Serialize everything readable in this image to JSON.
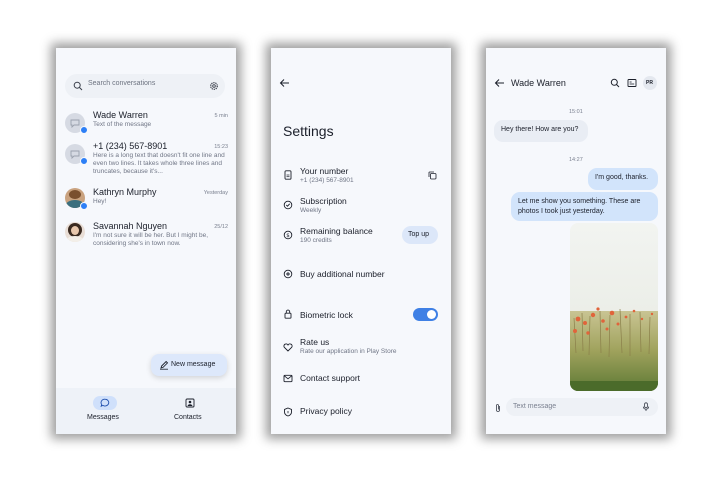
{
  "conversations_screen": {
    "search_placeholder": "Search conversations",
    "conversations": [
      {
        "name": "Wade Warren",
        "time": "5 min",
        "message": "Text of the message",
        "unread": true
      },
      {
        "name": "+1 (234) 567-8901",
        "time": "15:23",
        "message": "Here is a long text that doesn't fit one line and even two lines. It takes whole three lines and truncates, because it's...",
        "unread": true
      },
      {
        "name": "Kathryn Murphy",
        "time": "Yesterday",
        "message": "Hey!",
        "unread": true
      },
      {
        "name": "Savannah Nguyen",
        "time": "25/12",
        "message": "I'm not sure it will be her. But I might be, considering she's in town now.",
        "unread": false
      }
    ],
    "new_message_label": "New message",
    "nav": {
      "messages": "Messages",
      "contacts": "Contacts"
    }
  },
  "settings_screen": {
    "title": "Settings",
    "your_number": {
      "label": "Your number",
      "value": "+1 (234) 567-8901"
    },
    "subscription": {
      "label": "Subscription",
      "value": "Weekly"
    },
    "balance": {
      "label": "Remaining balance",
      "value": "190 credits",
      "button": "Top up"
    },
    "buy_number": "Buy additional number",
    "biometric_lock": {
      "label": "Biometric lock",
      "enabled": true
    },
    "rate_us": {
      "label": "Rate us",
      "sub": "Rate our application in Play Store"
    },
    "contact_support": "Contact support",
    "privacy_policy": "Privacy policy"
  },
  "chat_screen": {
    "contact_name": "Wade Warren",
    "avatar_initials": "PR",
    "time_1": "15:01",
    "msg_1": "Hey there! How are you?",
    "time_2": "14:27",
    "msg_2": "I'm good, thanks.",
    "msg_3": "Let me show you something. These are photos I took just yesterday.",
    "input_placeholder": "Text message"
  },
  "colors": {
    "accent": "#3f80e5",
    "unread_dot": "#2d7ff6",
    "outgoing_bubble": "#d2e4fb",
    "incoming_bubble": "#e9edf4",
    "screen_bg": "#f6f8fc"
  },
  "icons": [
    "search-icon",
    "settings-gear-icon",
    "person-avatar-icon",
    "pencil-icon",
    "chat-icon",
    "contacts-icon",
    "back-arrow-icon",
    "phone-number-icon",
    "copy-icon",
    "subscription-icon",
    "dollar-icon",
    "plus-icon",
    "lock-icon",
    "heart-icon",
    "mail-icon",
    "shield-icon",
    "phone-call-icon",
    "message-list-icon",
    "paperclip-icon",
    "microphone-icon"
  ]
}
